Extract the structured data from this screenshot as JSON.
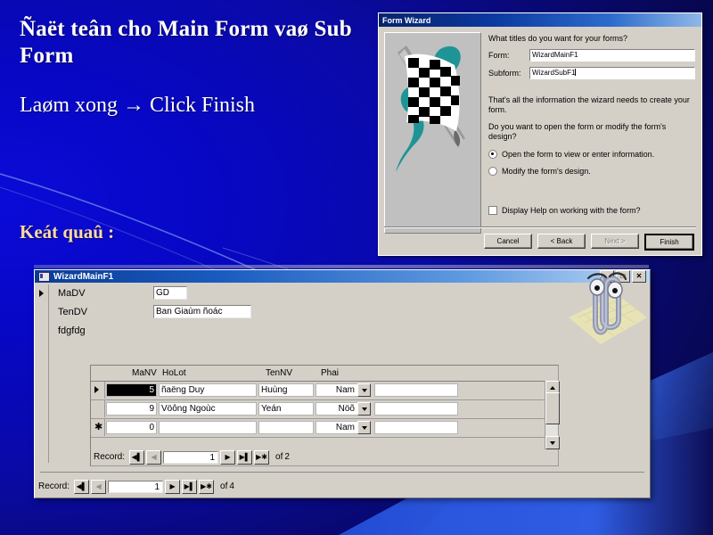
{
  "slide": {
    "title": "Ñaët teân cho Main Form vaø Sub Form",
    "line2": "Laøm xong →  Click Finish",
    "result_label": "Keát quaû :",
    "colors": {
      "accent_text": "#ffd9a0",
      "body_text": "#ffffff",
      "bg_blue": "#0707c6"
    }
  },
  "wizard": {
    "title": "Form Wizard",
    "question": "What titles do you want for your forms?",
    "fields": [
      {
        "label": "Form:",
        "value": "WizardMainF1"
      },
      {
        "label": "Subform:",
        "value": "WizardSubF1"
      }
    ],
    "paragraph1": "That's all the information the wizard needs to create your form.",
    "paragraph2": "Do you want to open the form or modify the form's design?",
    "radios": [
      {
        "label": "Open the form to view or enter information.",
        "selected": true
      },
      {
        "label": "Modify the form's design.",
        "selected": false
      }
    ],
    "checkbox": {
      "label": "Display Help on working with the form?",
      "checked": false
    },
    "buttons": [
      {
        "label": "Cancel",
        "state": "enabled"
      },
      {
        "label": "< Back",
        "state": "enabled"
      },
      {
        "label": "Next >",
        "state": "disabled"
      },
      {
        "label": "Finish",
        "state": "default"
      }
    ],
    "illustration": "checkered-flag-icon"
  },
  "access_form": {
    "title": "WizardMainF1",
    "window_buttons": [
      "minimize",
      "restore",
      "close"
    ],
    "main_fields": [
      {
        "label": "MaDV",
        "value": "GD"
      },
      {
        "label": "TenDV",
        "value": "Ban Giaùm ñoác"
      }
    ],
    "subform_label": "fdgfdg",
    "subform": {
      "columns": [
        "MaNV",
        "HoLot",
        "TenNV",
        "Phai",
        ""
      ],
      "rows": [
        {
          "marker": "current",
          "MaNV": "5",
          "MaNV_selected": true,
          "HoLot": "ñaëng Duy",
          "TenNV": "Huùng",
          "Phai": "Nam",
          "extra": ""
        },
        {
          "marker": "",
          "MaNV": "9",
          "MaNV_selected": false,
          "HoLot": "Vöông Ngoùc",
          "TenNV": "Yeán",
          "Phai": "Nöõ",
          "extra": ""
        },
        {
          "marker": "new",
          "MaNV": "0",
          "MaNV_selected": false,
          "HoLot": "",
          "TenNV": "",
          "Phai": "Nam",
          "extra": ""
        }
      ],
      "nav": {
        "label": "Record:",
        "current": "1",
        "of_label": "of",
        "total": "2"
      }
    },
    "nav": {
      "label": "Record:",
      "current": "1",
      "of_label": "of",
      "total": "4"
    },
    "assistant": "clippy-paperclip-icon"
  }
}
